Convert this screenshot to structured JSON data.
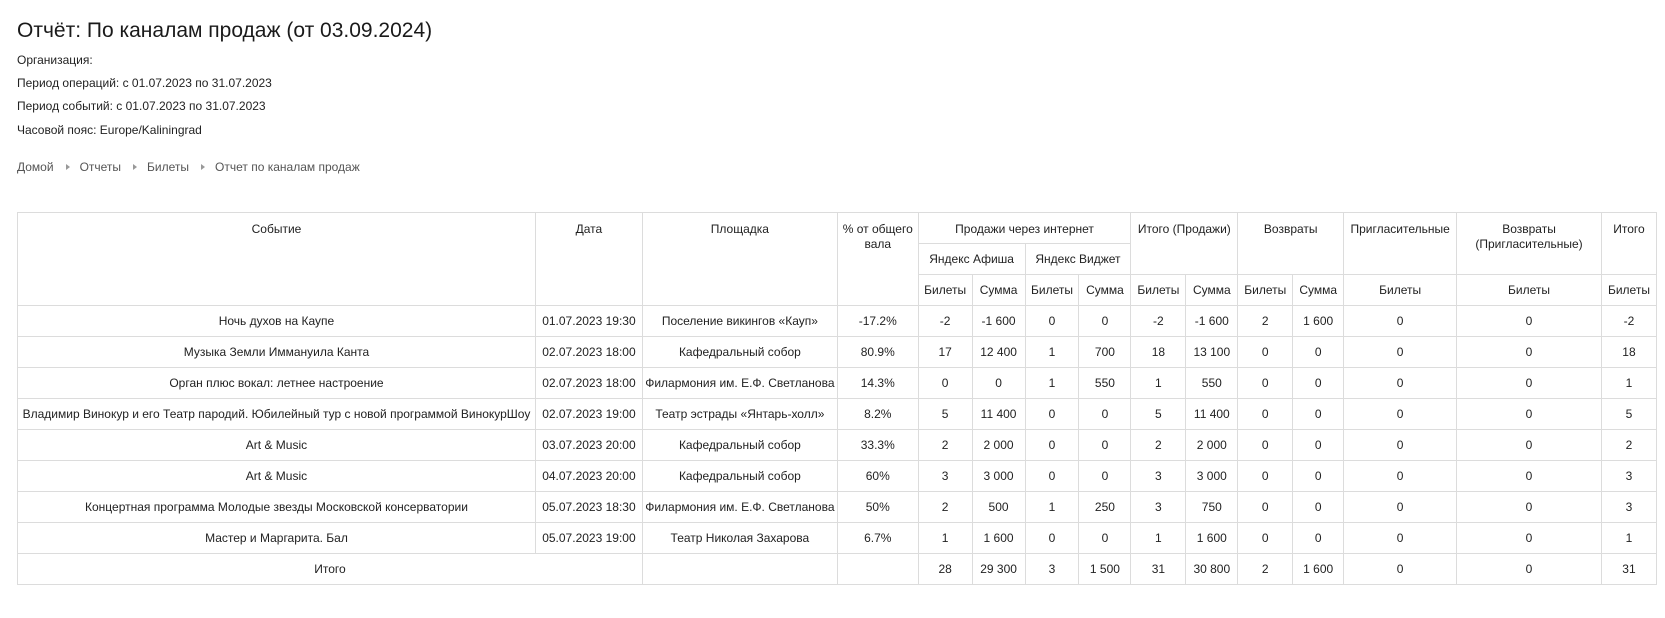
{
  "report": {
    "title": "Отчёт: По каналам продаж (от 03.09.2024)",
    "organization": "Организация:",
    "operations_period": "Период операций: с 01.07.2023 по 31.07.2023",
    "events_period": "Период событий: с 01.07.2023 по 31.07.2023",
    "timezone": "Часовой пояс: Europe/Kaliningrad"
  },
  "breadcrumb": [
    "Домой",
    "Отчеты",
    "Билеты",
    "Отчет по каналам продаж"
  ],
  "table": {
    "headers": {
      "event": "Событие",
      "date": "Дата",
      "venue": "Площадка",
      "percent": "% от общего вала",
      "internet_sales": "Продажи через интернет",
      "yandex_afisha": "Яндекс Афиша",
      "yandex_widget": "Яндекс Виджет",
      "total_sales": "Итого (Продажи)",
      "returns": "Возвраты",
      "invitations": "Пригласительные",
      "invitation_returns": "Возвраты (Пригласительные)",
      "total": "Итого",
      "tickets": "Билеты",
      "sum": "Сумма"
    },
    "rows": [
      [
        "Ночь духов на Каупе",
        "01.07.2023 19:30",
        "Поселение викингов «Кауп»",
        "-17.2%",
        "-2",
        "-1 600",
        "0",
        "0",
        "-2",
        "-1 600",
        "2",
        "1 600",
        "0",
        "0",
        "-2"
      ],
      [
        "Музыка Земли Иммануила Канта",
        "02.07.2023 18:00",
        "Кафедральный собор",
        "80.9%",
        "17",
        "12 400",
        "1",
        "700",
        "18",
        "13 100",
        "0",
        "0",
        "0",
        "0",
        "18"
      ],
      [
        "Орган плюс вокал: летнее настроение",
        "02.07.2023 18:00",
        "Филармония им. Е.Ф. Светланова",
        "14.3%",
        "0",
        "0",
        "1",
        "550",
        "1",
        "550",
        "0",
        "0",
        "0",
        "0",
        "1"
      ],
      [
        "Владимир Винокур и его Театр пародий. Юбилейный тур с новой программой ВинокурШоу",
        "02.07.2023 19:00",
        "Театр эстрады «Янтарь-холл»",
        "8.2%",
        "5",
        "11 400",
        "0",
        "0",
        "5",
        "11 400",
        "0",
        "0",
        "0",
        "0",
        "5"
      ],
      [
        "Art & Music",
        "03.07.2023 20:00",
        "Кафедральный собор",
        "33.3%",
        "2",
        "2 000",
        "0",
        "0",
        "2",
        "2 000",
        "0",
        "0",
        "0",
        "0",
        "2"
      ],
      [
        "Art & Music",
        "04.07.2023 20:00",
        "Кафедральный собор",
        "60%",
        "3",
        "3 000",
        "0",
        "0",
        "3",
        "3 000",
        "0",
        "0",
        "0",
        "0",
        "3"
      ],
      [
        "Концертная программа Молодые звезды Московской консерватории",
        "05.07.2023 18:30",
        "Филармония им. Е.Ф. Светланова",
        "50%",
        "2",
        "500",
        "1",
        "250",
        "3",
        "750",
        "0",
        "0",
        "0",
        "0",
        "3"
      ],
      [
        "Мастер и Маргарита. Бал",
        "05.07.2023 19:00",
        "Театр Николая Захарова",
        "6.7%",
        "1",
        "1 600",
        "0",
        "0",
        "1",
        "1 600",
        "0",
        "0",
        "0",
        "0",
        "1"
      ]
    ],
    "totals": {
      "label": "Итого",
      "venue": "",
      "percent": "",
      "values": [
        "28",
        "29 300",
        "3",
        "1 500",
        "31",
        "30 800",
        "2",
        "1 600",
        "0",
        "0",
        "31"
      ]
    }
  }
}
